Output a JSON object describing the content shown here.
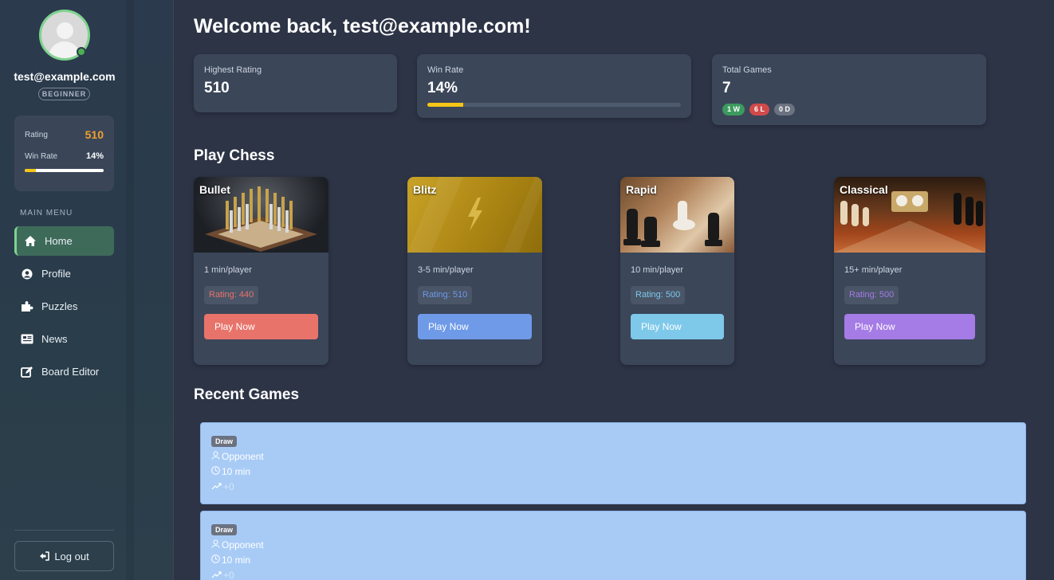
{
  "sidebar": {
    "user_email": "test@example.com",
    "level_badge": "BEGINNER",
    "stats": {
      "rating_label": "Rating",
      "rating_value": "510",
      "win_rate_label": "Win Rate",
      "win_rate_value": "14%",
      "win_rate_fraction": 0.14
    },
    "menu_title": "MAIN MENU",
    "menu_items": [
      {
        "label": "Home",
        "icon": "home-icon",
        "active": true
      },
      {
        "label": "Profile",
        "icon": "user-circle-icon",
        "active": false
      },
      {
        "label": "Puzzles",
        "icon": "puzzle-icon",
        "active": false
      },
      {
        "label": "News",
        "icon": "newspaper-icon",
        "active": false
      },
      {
        "label": "Board Editor",
        "icon": "edit-icon",
        "active": false
      }
    ],
    "logout_label": "Log out"
  },
  "main": {
    "welcome": "Welcome back, test@example.com!",
    "stats": {
      "highest_rating_label": "Highest Rating",
      "highest_rating_value": "510",
      "win_rate_label": "Win Rate",
      "win_rate_value": "14%",
      "win_rate_fraction": 0.14,
      "total_games_label": "Total Games",
      "total_games_value": "7",
      "wins": "1 W",
      "losses": "6 L",
      "draws": "0 D"
    },
    "play_title": "Play Chess",
    "game_modes": [
      {
        "title": "Bullet",
        "time": "1 min/player",
        "rating": "Rating: 440",
        "rating_color": "#e8736a",
        "button": "Play Now",
        "button_color": "#e8736a"
      },
      {
        "title": "Blitz",
        "time": "3-5 min/player",
        "rating": "Rating: 510",
        "rating_color": "#6e9ae8",
        "button": "Play Now",
        "button_color": "#6e9ae8"
      },
      {
        "title": "Rapid",
        "time": "10 min/player",
        "rating": "Rating: 500",
        "rating_color": "#7ec8ea",
        "button": "Play Now",
        "button_color": "#7ec8ea"
      },
      {
        "title": "Classical",
        "time": "15+ min/player",
        "rating": "Rating: 500",
        "rating_color": "#a57be6",
        "button": "Play Now",
        "button_color": "#a57be6"
      }
    ],
    "recent_title": "Recent Games",
    "recent_games": [
      {
        "result": "Draw",
        "opponent": "Opponent",
        "time_control": "10 min",
        "rating_change": "+0"
      },
      {
        "result": "Draw",
        "opponent": "Opponent",
        "time_control": "10 min",
        "rating_change": "+0"
      }
    ]
  },
  "colors": {
    "accent_green": "#7fd38f",
    "rating_orange": "#f0a030",
    "progress_yellow": "#f5c518",
    "recent_bg": "#a8cbf6"
  }
}
